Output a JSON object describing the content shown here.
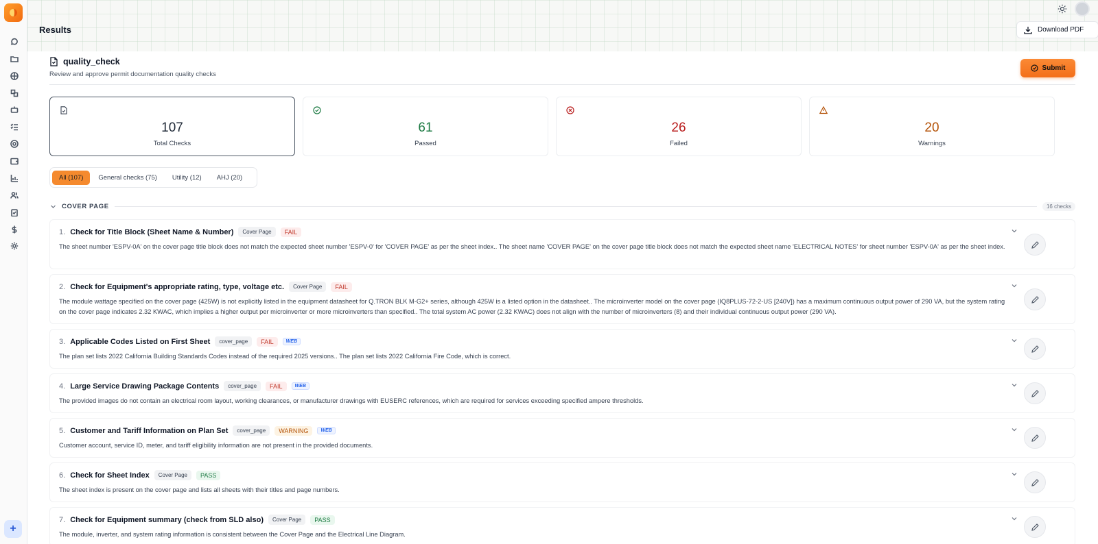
{
  "header": {
    "title": "Results",
    "download_label": "Download PDF"
  },
  "page": {
    "title": "quality_check",
    "subtitle": "Review and approve permit documentation quality checks",
    "submit_label": "Submit"
  },
  "stats": [
    {
      "value": "107",
      "label": "Total Checks",
      "color": "#1f2937",
      "icon": "file-check-icon"
    },
    {
      "value": "61",
      "label": "Passed",
      "color": "#1e7b44",
      "icon": "check-circle-icon"
    },
    {
      "value": "26",
      "label": "Failed",
      "color": "#b91c1c",
      "icon": "x-circle-icon"
    },
    {
      "value": "20",
      "label": "Warnings",
      "color": "#b45309",
      "icon": "warning-icon"
    }
  ],
  "tabs": [
    {
      "label": "All (107)",
      "active": true
    },
    {
      "label": "General checks (75)",
      "active": false
    },
    {
      "label": "Utility (12)",
      "active": false
    },
    {
      "label": "AHJ (20)",
      "active": false
    }
  ],
  "section": {
    "title": "COVER PAGE",
    "count": "16 checks"
  },
  "checks": [
    {
      "num": "1.",
      "title": "Check for Title Block (Sheet Name & Number)",
      "tag": "Cover Page",
      "status": "FAIL",
      "web": "",
      "desc": "The sheet number 'ESPV-0A' on the cover page title block does not match the expected sheet number 'ESPV-0' for 'COVER PAGE' as per the sheet index.. The sheet name 'COVER PAGE' on the cover page title block does not match the expected sheet name 'ELECTRICAL NOTES' for sheet number 'ESPV-0A' as per the sheet index."
    },
    {
      "num": "2.",
      "title": "Check for Equipment's appropriate rating, type, voltage etc.",
      "tag": "Cover Page",
      "status": "FAIL",
      "web": "",
      "desc": "The module wattage specified on the cover page (425W) is not explicitly listed in the equipment datasheet for Q.TRON BLK M-G2+ series, although 425W is a listed option in the datasheet.. The microinverter model on the cover page (IQ8PLUS-72-2-US [240V]) has a maximum continuous output power of 290 VA, but the system rating on the cover page indicates 2.32 KWAC, which implies a higher output per microinverter or more microinverters than specified.. The total system AC power (2.32 KWAC) does not align with the number of microinverters (8) and their individual continuous output power (290 VA)."
    },
    {
      "num": "3.",
      "title": "Applicable Codes Listed on First Sheet",
      "tag": "cover_page",
      "status": "FAIL",
      "web": "WEB",
      "desc": "The plan set lists 2022 California Building Standards Codes instead of the required 2025 versions.. The plan set lists 2022 California Fire Code, which is correct."
    },
    {
      "num": "4.",
      "title": "Large Service Drawing Package Contents",
      "tag": "cover_page",
      "status": "FAIL",
      "web": "WEB",
      "desc": "The provided images do not contain an electrical room layout, working clearances, or manufacturer drawings with EUSERC references, which are required for services exceeding specified ampere thresholds."
    },
    {
      "num": "5.",
      "title": "Customer and Tariff Information on Plan Set",
      "tag": "cover_page",
      "status": "WARNING",
      "web": "WEB",
      "desc": "Customer account, service ID, meter, and tariff eligibility information are not present in the provided documents."
    },
    {
      "num": "6.",
      "title": "Check for Sheet Index",
      "tag": "Cover Page",
      "status": "PASS",
      "web": "",
      "desc": "The sheet index is present on the cover page and lists all sheets with their titles and page numbers."
    },
    {
      "num": "7.",
      "title": "Check for Equipment summary (check from SLD also)",
      "tag": "Cover Page",
      "status": "PASS",
      "web": "",
      "desc": "The module, inverter, and system rating information is consistent between the Cover Page and the Electrical Line Diagram."
    }
  ]
}
